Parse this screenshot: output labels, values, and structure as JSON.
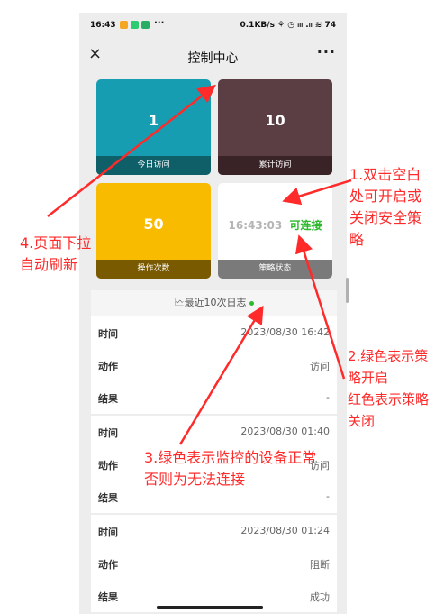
{
  "status_bar": {
    "time": "16:43",
    "right": "0.1KB/s ⚘ ◷ ᵢₗₗ .ₗₗ ≋ 74"
  },
  "nav": {
    "close_icon": "×",
    "title": "控制中心",
    "more_icon": "···"
  },
  "tiles": [
    {
      "value": "1",
      "label": "今日访问",
      "color": "#169db1",
      "footer_color": "#0f5f68"
    },
    {
      "value": "10",
      "label": "累计访问",
      "color": "#5b3e43",
      "footer_color": "#3a2326"
    },
    {
      "value": "50",
      "label": "操作次数",
      "color": "#f8bb00",
      "footer_color": "#7a5a00"
    },
    {
      "time": "16:43:03",
      "status": "可连接",
      "label": "策略状态",
      "color": "#ffffff",
      "footer_color": "#7a7a7a"
    }
  ],
  "logs": {
    "header": "🗠最近10次日志",
    "entries": [
      {
        "time_k": "时间",
        "time_v": "2023/08/30 16:42",
        "action_k": "动作",
        "action_v": "访问",
        "result_k": "结果",
        "result_v": "-"
      },
      {
        "time_k": "时间",
        "time_v": "2023/08/30 01:40",
        "action_k": "动作",
        "action_v": "访问",
        "result_k": "结果",
        "result_v": "-"
      },
      {
        "time_k": "时间",
        "time_v": "2023/08/30 01:24",
        "action_k": "动作",
        "action_v": "阻断",
        "result_k": "结果",
        "result_v": "成功"
      }
    ]
  },
  "annotations": {
    "a1": [
      "1.双击空白",
      "处可开启或",
      "关闭安全策",
      "略"
    ],
    "a2": [
      "2.绿色表示策",
      "略开启",
      "红色表示策略",
      "关闭"
    ],
    "a3": [
      "3.绿色表示监控的设备正常",
      "否则为无法连接"
    ],
    "a4": [
      "4.页面下拉",
      "自动刷新"
    ]
  }
}
